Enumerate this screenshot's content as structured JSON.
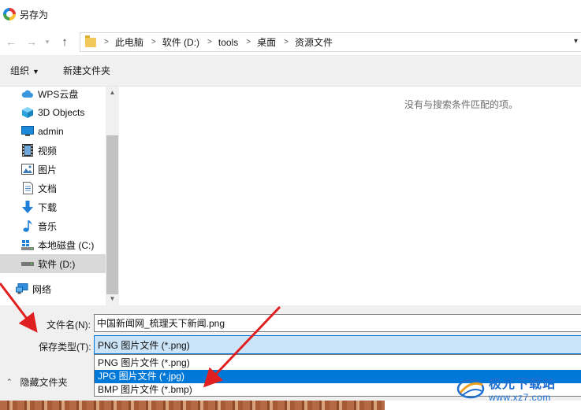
{
  "window": {
    "title": "另存为"
  },
  "address": {
    "breadcrumbs": [
      "此电脑",
      "软件 (D:)",
      "tools",
      "桌面",
      "资源文件"
    ]
  },
  "toolbar": {
    "organize": "组织",
    "new_folder": "新建文件夹"
  },
  "nav": {
    "items": [
      {
        "label": "WPS云盘",
        "icon": "cloud-icon"
      },
      {
        "label": "3D Objects",
        "icon": "cube-icon"
      },
      {
        "label": "admin",
        "icon": "monitor-icon"
      },
      {
        "label": "视频",
        "icon": "film-icon"
      },
      {
        "label": "图片",
        "icon": "image-icon"
      },
      {
        "label": "文档",
        "icon": "document-icon"
      },
      {
        "label": "下载",
        "icon": "download-arrow-icon"
      },
      {
        "label": "音乐",
        "icon": "music-note-icon"
      },
      {
        "label": "本地磁盘 (C:)",
        "icon": "drive-c-icon"
      },
      {
        "label": "软件 (D:)",
        "icon": "drive-d-icon",
        "selected": true
      },
      {
        "label": "网络",
        "icon": "network-icon"
      }
    ]
  },
  "main": {
    "empty_message": "没有与搜索条件匹配的项。"
  },
  "save": {
    "filename_label": "文件名(N):",
    "filename_value": "中国新闻网_梳理天下新闻.png",
    "filetype_label": "保存类型(T):",
    "filetype_selected": "PNG 图片文件 (*.png)",
    "filetype_options": [
      "PNG 图片文件 (*.png)",
      "JPG 图片文件 (*.jpg)",
      "BMP 图片文件 (*.bmp)"
    ],
    "highlighted_option": "JPG 图片文件 (*.jpg)",
    "hide_folders": "隐藏文件夹"
  },
  "watermark": {
    "main": "极光下载站",
    "sub": "www.xz7.com"
  },
  "colors": {
    "selection": "#0078d7",
    "select_bg": "#cce4f7",
    "annotation_arrow": "#e02020",
    "watermark": "#1f6fd1"
  }
}
